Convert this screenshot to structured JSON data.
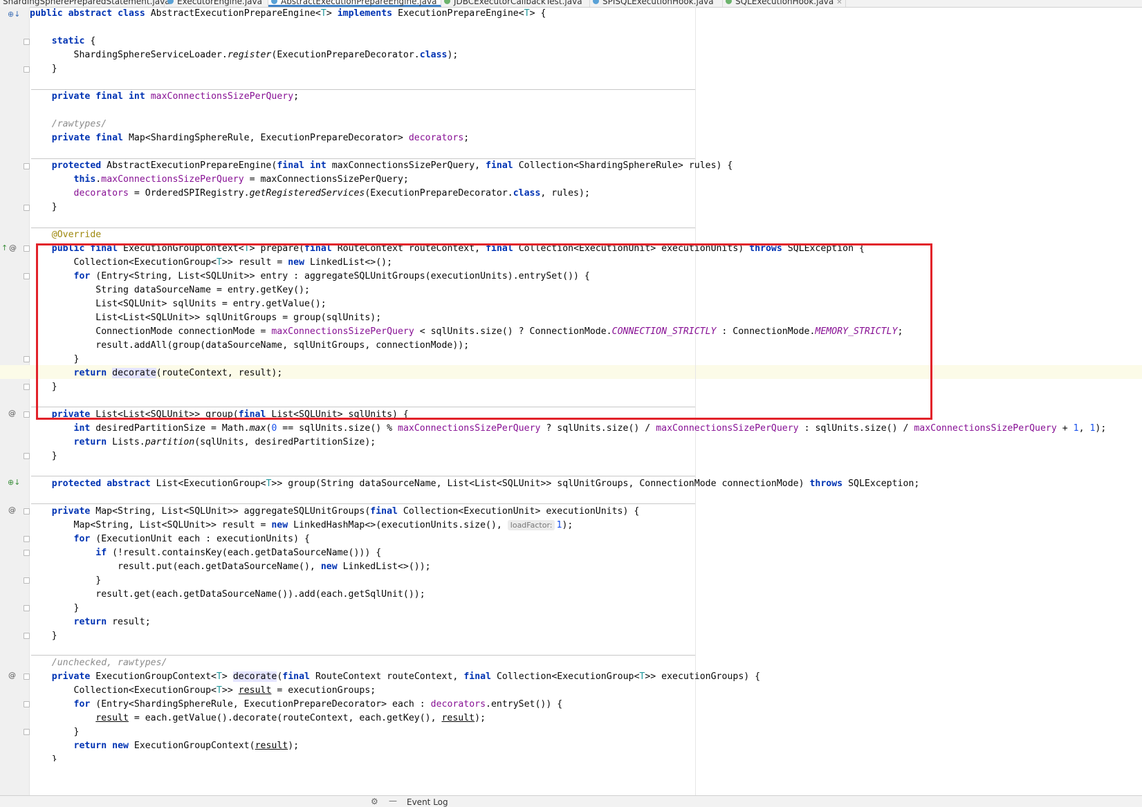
{
  "tabs": [
    {
      "label": "ShardingSpherePreparedStatement.java"
    },
    {
      "label": "ExecutorEngine.java"
    },
    {
      "label": "AbstractExecutionPrepareEngine.java",
      "active": true
    },
    {
      "label": "JDBCExecutorCallbackTest.java"
    },
    {
      "label": "SPISQLExecutionHook.java"
    },
    {
      "label": "SQLExecutionHook.java"
    }
  ],
  "code": {
    "class_decl": [
      "public",
      "abstract",
      "class",
      "AbstractExecutionPrepareEngine<",
      "T",
      "> ",
      "implements",
      " ExecutionPrepareEngine<",
      "T",
      "> {"
    ],
    "l_static": "static",
    "l_static_brace": " {",
    "l_register": [
      "ShardingSphereServiceLoader.",
      "register",
      "(ExecutionPrepareDecorator.",
      "class",
      ");"
    ],
    "close_brace": "}",
    "l_field1": [
      "private",
      "final",
      "int",
      "maxConnectionsSizePerQuery",
      ";"
    ],
    "l_comment1": "/rawtypes/",
    "l_field2": [
      "private",
      "final",
      " Map<ShardingSphereRule, ExecutionPrepareDecorator> ",
      "decorators",
      ";"
    ],
    "l_ctor": [
      "protected",
      " AbstractExecutionPrepareEngine(",
      "final",
      "int",
      " maxConnectionsSizePerQuery, ",
      "final",
      " Collection<ShardingSphereRule> rules) {"
    ],
    "l_ctor_b1": [
      "this",
      ".",
      "maxConnectionsSizePerQuery",
      " = maxConnectionsSizePerQuery;"
    ],
    "l_ctor_b2": [
      "decorators",
      " = OrderedSPIRegistry.",
      "getRegisteredServices",
      "(ExecutionPrepareDecorator.",
      "class",
      ", rules);"
    ],
    "l_override": "@Override",
    "l_prepare": [
      "public",
      "final",
      " ExecutionGroupContext<",
      "T",
      "> prepare(",
      "final",
      " RouteContext routeContext, ",
      "final",
      " Collection<ExecutionUnit> executionUnits) ",
      "throws",
      " SQLException {"
    ],
    "l_p1": [
      "Collection<ExecutionGroup<",
      "T",
      ">> result = ",
      "new",
      " LinkedList<>();"
    ],
    "l_p2": [
      "for",
      " (Entry<String, List<SQLUnit>> entry : aggregateSQLUnitGroups(executionUnits).entrySet()) {"
    ],
    "l_p3": [
      "String dataSourceName = entry.getKey();"
    ],
    "l_p4": [
      "List<SQLUnit> sqlUnits = entry.getValue();"
    ],
    "l_p5": [
      "List<List<SQLUnit>> sqlUnitGroups = group(sqlUnits);"
    ],
    "l_p6": [
      "ConnectionMode connectionMode = ",
      "maxConnectionsSizePerQuery",
      " < sqlUnits.size() ? ConnectionMode.",
      "CONNECTION_STRICTLY",
      " : ConnectionMode.",
      "MEMORY_STRICTLY",
      ";"
    ],
    "l_p7": [
      "result.addAll(group(dataSourceName, sqlUnitGroups, connectionMode));"
    ],
    "l_p9": [
      "return",
      " ",
      "decorate",
      "(routeContext, result);"
    ],
    "l_group": [
      "private",
      " List<List<SQLUnit>> group(",
      "final",
      " List<SQLUnit> sqlUnits) {"
    ],
    "l_g1": [
      "int",
      " desiredPartitionSize = Math.",
      "max",
      "(",
      "0",
      " == sqlUnits.size() % ",
      "maxConnectionsSizePerQuery",
      " ? sqlUnits.size() / ",
      "maxConnectionsSizePerQuery",
      " : sqlUnits.size() / ",
      "maxConnectionsSizePerQuery",
      " + ",
      "1",
      ", ",
      "1",
      ");"
    ],
    "l_g2": [
      "return",
      " Lists.",
      "partition",
      "(sqlUnits, desiredPartitionSize);"
    ],
    "l_abstract": [
      "protected",
      "abstract",
      " List<ExecutionGroup<",
      "T",
      ">> group(String dataSourceName, List<List<SQLUnit>> sqlUnitGroups, ConnectionMode connectionMode) ",
      "throws",
      " SQLException;"
    ],
    "l_agg": [
      "private",
      " Map<String, List<SQLUnit>> aggregateSQLUnitGroups(",
      "final",
      " Collection<ExecutionUnit> executionUnits) {"
    ],
    "l_a1": [
      "Map<String, List<SQLUnit>> result = ",
      "new",
      " LinkedHashMap<>(executionUnits.size(), ",
      "loadFactor:",
      "1",
      ");"
    ],
    "l_a2": [
      "for",
      " (ExecutionUnit each : executionUnits) {"
    ],
    "l_a3": [
      "if",
      " (!result.containsKey(each.getDataSourceName())) {"
    ],
    "l_a4": [
      "result.put(each.getDataSourceName(), ",
      "new",
      " LinkedList<>());"
    ],
    "l_a6": [
      "result.get(each.getDataSourceName()).add(each.getSqlUnit());"
    ],
    "l_a8": [
      "return",
      " result;"
    ],
    "l_comment2": "/unchecked, rawtypes/",
    "l_dec": [
      "private",
      " ExecutionGroupContext<",
      "T",
      "> ",
      "decorate",
      "(",
      "final",
      " RouteContext routeContext, ",
      "final",
      " Collection<ExecutionGroup<",
      "T",
      ">> executionGroups) {"
    ],
    "l_d1": [
      "Collection<ExecutionGroup<",
      "T",
      ">> ",
      "result",
      " = executionGroups;"
    ],
    "l_d2": [
      "for",
      " (Entry<ShardingSphereRule, ExecutionPrepareDecorator> each : ",
      "decorators",
      ".entrySet()) {"
    ],
    "l_d3": [
      "result",
      " = each.getValue().decorate(routeContext, each.getKey(), ",
      "result",
      ");"
    ],
    "l_d5": [
      "return",
      "new",
      " ExecutionGroupContext(",
      "result",
      ");"
    ],
    "l_last": "}"
  },
  "status": {
    "event_log": "Event Log"
  },
  "colors": {
    "highlight_box": "#e2222a",
    "keyword": "#0033b3",
    "field": "#871094"
  }
}
